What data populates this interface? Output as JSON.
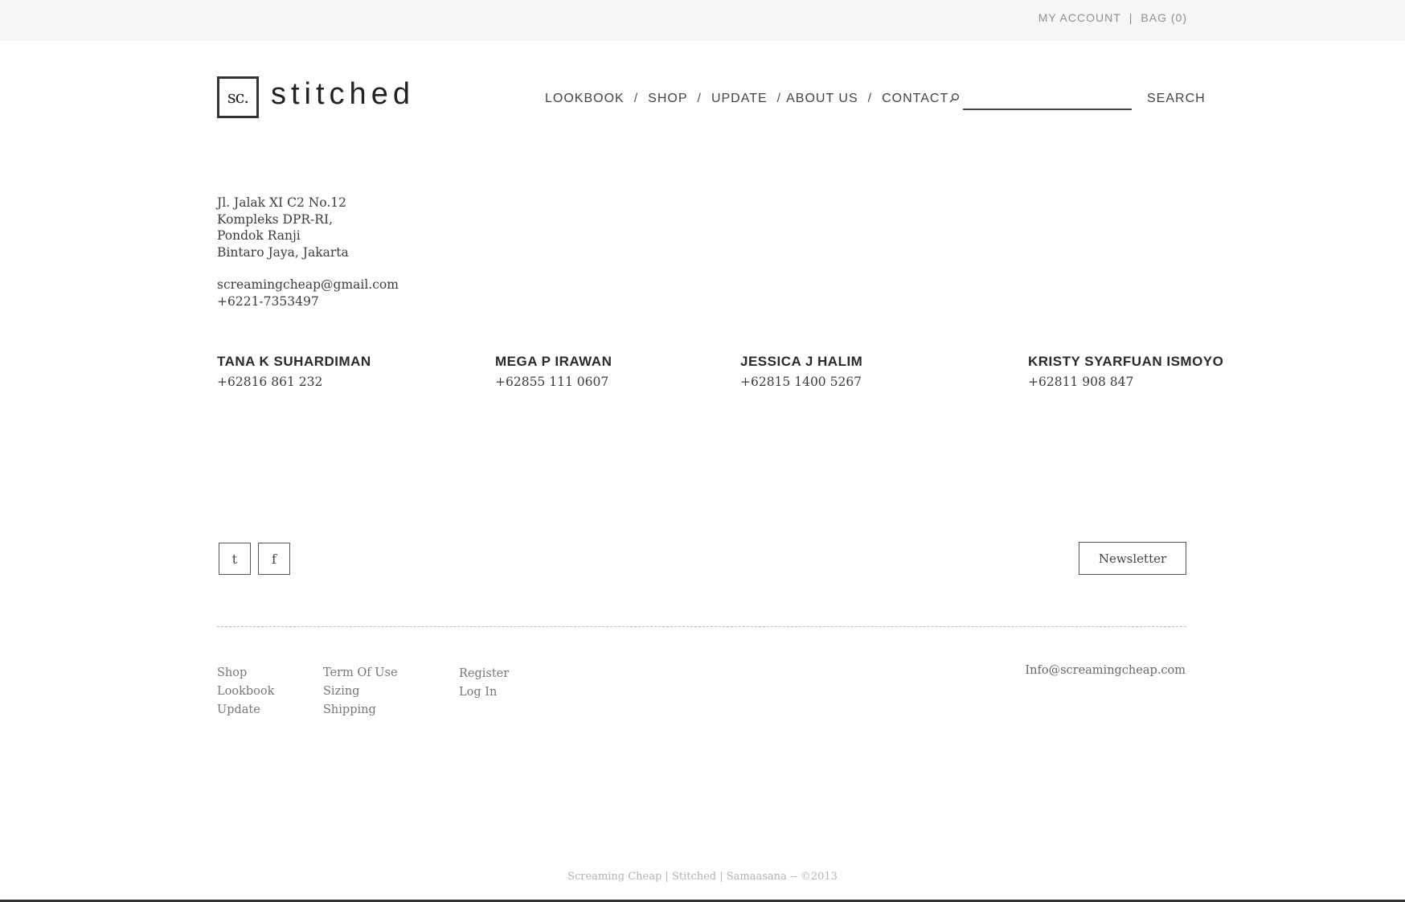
{
  "topbar": {
    "my_account": "MY ACCOUNT",
    "divider": "|",
    "bag": "BAG (0)"
  },
  "brand": {
    "mark": "sc.",
    "word": "stitched"
  },
  "nav": {
    "items": [
      "LOOKBOOK",
      "SHOP",
      "UPDATE",
      "ABOUT US",
      "CONTACT"
    ],
    "separator": "/"
  },
  "search": {
    "placeholder": "",
    "button": "SEARCH",
    "icon": "search-icon"
  },
  "address": {
    "lines": [
      "Jl. Jalak XI C2 No.12",
      "Kompleks DPR-RI,",
      "Pondok Ranji",
      "Bintaro Jaya, Jakarta"
    ],
    "email": "screamingcheap@gmail.com",
    "phone": "+6221-7353497"
  },
  "people": [
    {
      "name": "TANA K SUHARDIMAN",
      "phone": "+62816 861 232"
    },
    {
      "name": "MEGA P IRAWAN",
      "phone": "+62855 111 0607"
    },
    {
      "name": "JESSICA J HALIM",
      "phone": "+62815 1400 5267"
    },
    {
      "name": "KRISTY SYARFUAN ISMOYO",
      "phone": "+62811 908 847"
    }
  ],
  "social": {
    "twitter": "t",
    "facebook": "f"
  },
  "newsletter": "Newsletter",
  "footer": {
    "col1": [
      "Shop",
      "Lookbook",
      "Update"
    ],
    "col2": [
      "Term Of Use",
      "Sizing",
      "Shipping"
    ],
    "col3": [
      "Register",
      "Log In"
    ],
    "email": "Info@screamingcheap.com"
  },
  "copyright": "Screaming Cheap | Stitched  | Samaasana  --  ©2013"
}
